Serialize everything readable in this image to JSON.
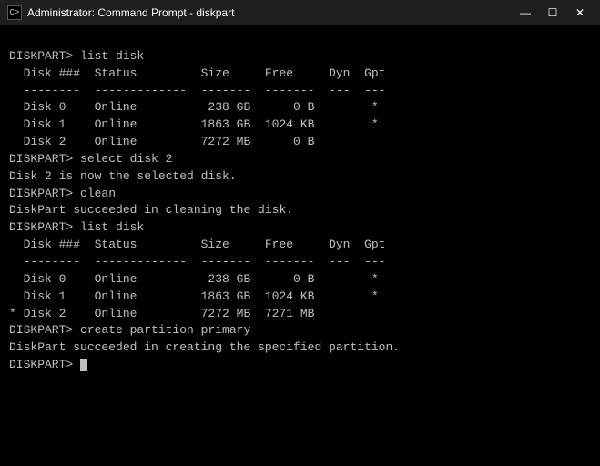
{
  "titleBar": {
    "icon": "C>",
    "title": "Administrator: Command Prompt - diskpart",
    "minimize": "—",
    "maximize": "☐",
    "close": "✕"
  },
  "console": {
    "lines": [
      "DISKPART> list disk",
      "",
      "  Disk ###  Status         Size     Free     Dyn  Gpt",
      "  --------  -------------  -------  -------  ---  ---",
      "  Disk 0    Online          238 GB      0 B        *",
      "  Disk 1    Online         1863 GB  1024 KB        *",
      "  Disk 2    Online         7272 MB      0 B",
      "",
      "DISKPART> select disk 2",
      "",
      "Disk 2 is now the selected disk.",
      "",
      "DISKPART> clean",
      "",
      "DiskPart succeeded in cleaning the disk.",
      "",
      "DISKPART> list disk",
      "",
      "  Disk ###  Status         Size     Free     Dyn  Gpt",
      "  --------  -------------  -------  -------  ---  ---",
      "  Disk 0    Online          238 GB      0 B        *",
      "  Disk 1    Online         1863 GB  1024 KB        *",
      "* Disk 2    Online         7272 MB  7271 MB",
      "",
      "DISKPART> create partition primary",
      "",
      "DiskPart succeeded in creating the specified partition.",
      "",
      "DISKPART> "
    ]
  }
}
